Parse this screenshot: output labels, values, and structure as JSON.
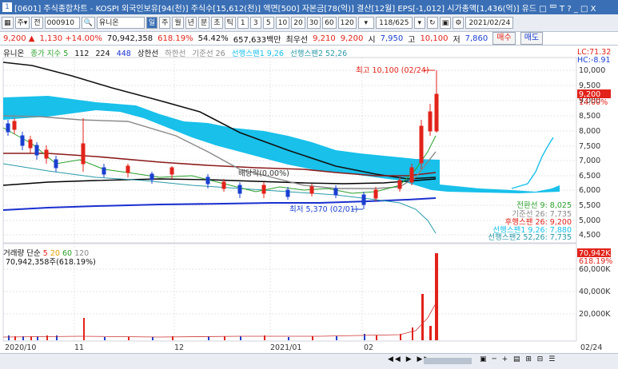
{
  "window": {
    "icon_label": "1",
    "title": "[0601] 주식종합차트 - KOSPI 외국인보유[94(천)] 주식수[15,612(천)] 액면[500] 자본금[78(억)] 결산[12월] EPS[-1,012] 시가총액[1,436(억)] 유드 □ 罒 T ? _ □ X"
  },
  "toolbar": {
    "type_label": "전",
    "code": "000910",
    "name": "유니온",
    "periods": [
      "일",
      "주",
      "월",
      "년",
      "분",
      "초",
      "틱"
    ],
    "minutes": [
      "1",
      "3",
      "5",
      "10",
      "20",
      "30",
      "60",
      "120"
    ],
    "page": "118/625",
    "date": "2021/02/24"
  },
  "quote": {
    "price": "9,200 ▲",
    "change": "1,130 +14.00%",
    "volume": "70,942,358",
    "vol_ratio": "618.19%",
    "turnover": "54.42%",
    "amount": "657,633백만",
    "min_label": "최우선",
    "bid": "9,210",
    "ask": "9,200",
    "open_label": "시",
    "open": "7,950",
    "high_label": "고",
    "high": "10,100",
    "low_label": "저",
    "low": "7,860",
    "buy_btn": "매수",
    "sell_btn": "매도"
  },
  "legend": {
    "name": "유니온",
    "ma_label": "종가 지수 5",
    "ma_vals": [
      "112",
      "224",
      "448"
    ],
    "upper": "상한선",
    "lower": "하한선",
    "base": "기준선 26",
    "span1": "선행스팬1 9,26",
    "span2": "선행스팬2 52,26"
  },
  "right_axis": {
    "lc": "LC:71.32",
    "hc": "HC:-8.91",
    "ticks": [
      "10,000",
      "9,500",
      "9,000",
      "8,500",
      "8,000",
      "7,500",
      "7,000",
      "6,500",
      "6,000",
      "5,500",
      "5,000",
      "4,500"
    ],
    "current": "9,200",
    "current_pct": "14.00%",
    "vol_ticks": [
      "60,000K",
      "40,000K",
      "20,000K"
    ],
    "vol_current": "70,942K",
    "vol_pct": "618.19%"
  },
  "annotations": {
    "high": "최고 10,100 (02/24)",
    "low": "최저 5,370 (02/01)",
    "dividend": "배당락(0.00%)",
    "conv": "전환선 9: 8,025",
    "base": "기준선 26: 7,735",
    "lag": "후행스팬 26: 9,200",
    "span1": "선행스팬1 9,26: 7,880",
    "span2": "선행스팬2 52,26: 7,735"
  },
  "volume": {
    "legend_label": "거래량 단순",
    "ma": [
      "5",
      "20",
      "60",
      "120"
    ],
    "value": "70,942,358주(618.19%)"
  },
  "dates": [
    "2020/10",
    "11",
    "12",
    "2021/01",
    "02",
    "02/24"
  ],
  "colors": {
    "up": "#e2231a",
    "down": "#1a3fd0",
    "cloud": "#18c0ea",
    "accent": "#3a6fb5"
  }
}
